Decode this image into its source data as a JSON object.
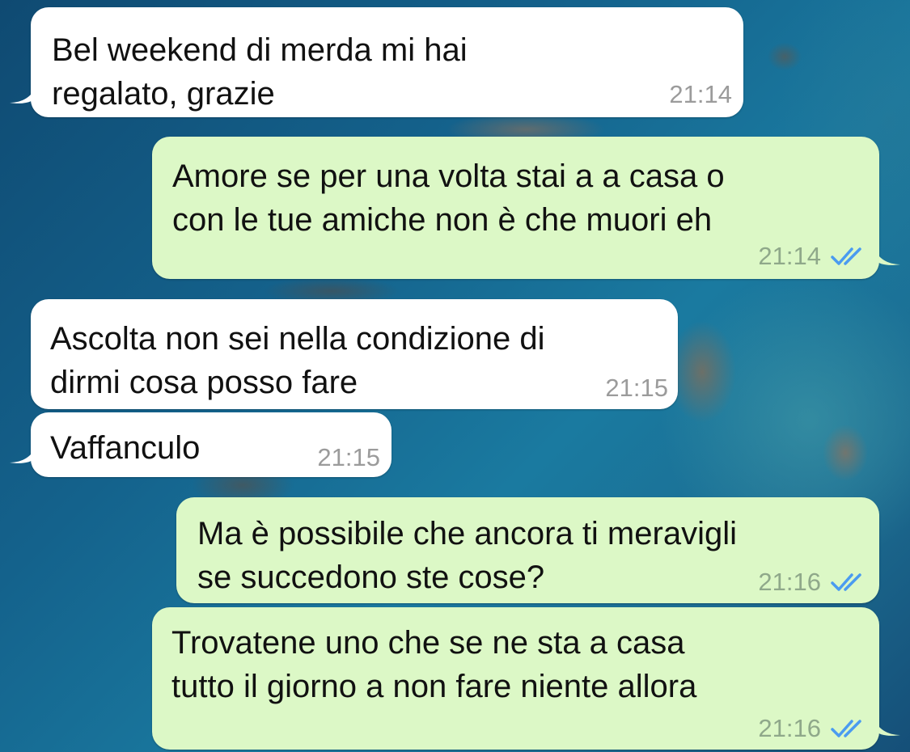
{
  "colors": {
    "incoming_bubble": "#ffffff",
    "outgoing_bubble": "#dcf8c6",
    "read_ticks": "#4a9bf0",
    "incoming_time": "#9b9b9b",
    "outgoing_time": "#8fa88a"
  },
  "icons": {
    "read_receipt": "double-check-icon"
  },
  "messages": [
    {
      "direction": "incoming",
      "text": "Bel weekend di merda mi hai\nregalato, grazie",
      "time": "21:14"
    },
    {
      "direction": "outgoing",
      "text": "Amore se per una volta stai a a casa o\ncon le tue amiche non è che muori eh",
      "time": "21:14",
      "status": "read"
    },
    {
      "direction": "incoming",
      "text": "Ascolta non sei nella condizione di\ndirmi cosa posso fare",
      "time": "21:15"
    },
    {
      "direction": "incoming",
      "text": "Vaffanculo",
      "time": "21:15"
    },
    {
      "direction": "outgoing",
      "text": "Ma è possibile che ancora ti meravigli\nse succedono ste cose?",
      "time": "21:16",
      "status": "read"
    },
    {
      "direction": "outgoing",
      "text": "Trovatene uno che se ne sta a casa\ntutto il giorno a non fare niente allora",
      "time": "21:16",
      "status": "read"
    }
  ]
}
